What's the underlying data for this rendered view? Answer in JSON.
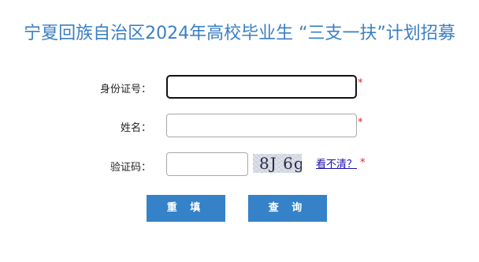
{
  "page": {
    "title": "宁夏回族自治区2024年高校毕业生 “三支一扶”计划招募"
  },
  "form": {
    "id_label": "身份证号：",
    "id_value": "",
    "name_label": "姓名：",
    "name_value": "",
    "captcha_label": "验证码：",
    "captcha_value": "",
    "required_mark": "*",
    "captcha_code": "8J 6g",
    "unclear_link": "看不清？"
  },
  "actions": {
    "reset_label": "重 填",
    "query_label": "查 询"
  },
  "colors": {
    "title": "#3b7fc4",
    "button": "#3582c8",
    "required": "#e02424"
  }
}
